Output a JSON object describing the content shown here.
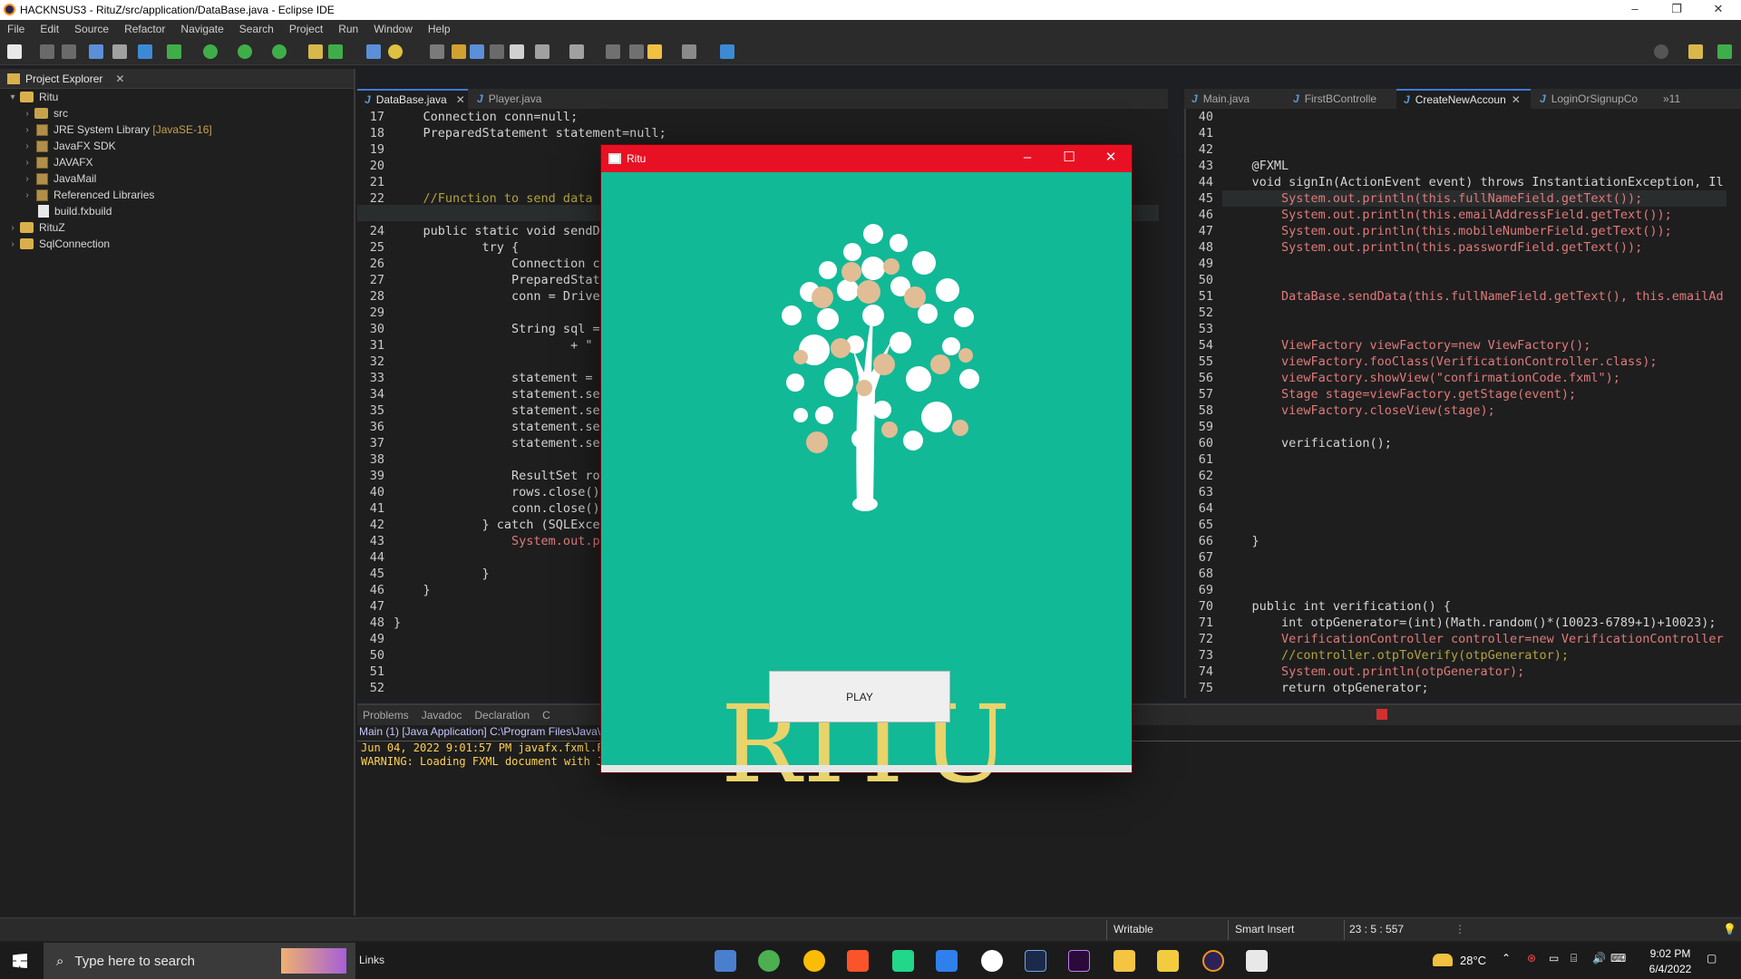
{
  "window": {
    "title": "HACKNSUS3 - RituZ/src/application/DataBase.java - Eclipse IDE",
    "minimize": "–",
    "maximize": "❐",
    "close": "✕"
  },
  "menu": [
    "File",
    "Edit",
    "Source",
    "Refactor",
    "Navigate",
    "Search",
    "Project",
    "Run",
    "Window",
    "Help"
  ],
  "explorer": {
    "title": "Project Explorer",
    "tree": [
      {
        "label": "Ritu",
        "extra": "",
        "type": "project"
      },
      {
        "label": "src",
        "extra": "",
        "type": "pkg"
      },
      {
        "label": "JRE System Library",
        "extra": "[JavaSE-16]",
        "type": "lib"
      },
      {
        "label": "JavaFX SDK",
        "extra": "",
        "type": "lib"
      },
      {
        "label": "JAVAFX",
        "extra": "",
        "type": "lib"
      },
      {
        "label": "JavaMail",
        "extra": "",
        "type": "lib"
      },
      {
        "label": "Referenced Libraries",
        "extra": "",
        "type": "lib"
      },
      {
        "label": "build.fxbuild",
        "extra": "",
        "type": "file"
      },
      {
        "label": "RituZ",
        "extra": "",
        "type": "project"
      },
      {
        "label": "SqlConnection",
        "extra": "",
        "type": "project"
      }
    ]
  },
  "editor_left": {
    "tabs": [
      "DataBase.java",
      "Player.java"
    ],
    "line_numbers": [
      "17",
      "18",
      "19",
      "20",
      "21",
      "22",
      "23",
      "24",
      "25",
      "26",
      "27",
      "28",
      "29",
      "30",
      "31",
      "32",
      "33",
      "34",
      "35",
      "36",
      "37",
      "38",
      "39",
      "40",
      "41",
      "42",
      "43",
      "44",
      "45",
      "46",
      "47",
      "48",
      "49",
      "50",
      "51",
      "52"
    ],
    "lines": [
      "    Connection conn=null;",
      "    PreparedStatement statement=null;",
      "",
      "",
      "",
      "    //Function to send data t",
      "",
      "    public static void sendDa",
      "            try {",
      "                Connection co",
      "                PreparedState",
      "                conn = Driver",
      "",
      "                String sql = ",
      "                        + \" V",
      "",
      "                statement = c",
      "                statement.set",
      "                statement.set",
      "                statement.set",
      "                statement.set",
      "",
      "                ResultSet row",
      "                rows.close();",
      "                conn.close();",
      "            } catch (SQLExcep",
      "                System.out.pr",
      "",
      "            }",
      "    }",
      "",
      "}",
      "",
      "",
      "",
      ""
    ]
  },
  "editor_right": {
    "tabs": [
      "Main.java",
      "FirstBControlle",
      "CreateNewAccoun",
      "LoginOrSignupCo",
      "»11"
    ],
    "line_numbers": [
      "40",
      "41",
      "42",
      "43",
      "44",
      "45",
      "46",
      "47",
      "48",
      "49",
      "50",
      "51",
      "52",
      "53",
      "54",
      "55",
      "56",
      "57",
      "58",
      "59",
      "60",
      "61",
      "62",
      "63",
      "64",
      "65",
      "66",
      "67",
      "68",
      "69",
      "70",
      "71",
      "72",
      "73",
      "74",
      "75"
    ],
    "lines": [
      "",
      "",
      "",
      "    @FXML",
      "    void signIn(ActionEvent event) throws InstantiationException, Il",
      "        System.out.println(this.fullNameField.getText());",
      "        System.out.println(this.emailAddressField.getText());",
      "        System.out.println(this.mobileNumberField.getText());",
      "        System.out.println(this.passwordField.getText());",
      "",
      "",
      "        DataBase.sendData(this.fullNameField.getText(), this.emailAd",
      "",
      "",
      "        ViewFactory viewFactory=new ViewFactory();",
      "        viewFactory.fooClass(VerificationController.class);",
      "        viewFactory.showView(\"confirmationCode.fxml\");",
      "        Stage stage=viewFactory.getStage(event);",
      "        viewFactory.closeView(stage);",
      "",
      "        verification();",
      "",
      "",
      "",
      "",
      "",
      "    }",
      "",
      "",
      "",
      "    public int verification() {",
      "        int otpGenerator=(int)(Math.random()*(10023-6789+1)+10023);",
      "        VerificationController controller=new VerificationController",
      "        //controller.otpToVerify(otpGenerator);",
      "        System.out.println(otpGenerator);",
      "        return otpGenerator;"
    ]
  },
  "console": {
    "tabs": [
      "Problems",
      "Javadoc",
      "Declaration",
      "C"
    ],
    "path": "Main (1) [Java Application] C:\\Program Files\\Java\\j",
    "output": [
      "Jun 04, 2022 9:01:57 PM javafx.fxml.FX",
      "WARNING: Loading FXML document with Ja"
    ]
  },
  "status": {
    "writable": "Writable",
    "insert": "Smart Insert",
    "position": "23 : 5 : 557"
  },
  "app_window": {
    "title": "Ritu",
    "brand": "RITU",
    "play_label": "PLAY",
    "minimize": "–",
    "maximize": "☐",
    "close": "✕"
  },
  "taskbar": {
    "search_placeholder": "Type here to search",
    "links": "Links",
    "temperature": "28°C",
    "time": "9:02 PM",
    "date": "6/4/2022"
  },
  "colors": {
    "ritu_background": "#12b996",
    "ritu_titlebar": "#e81123",
    "brand_text": "#e9d36b",
    "editor_bg": "#1e1e1e"
  }
}
